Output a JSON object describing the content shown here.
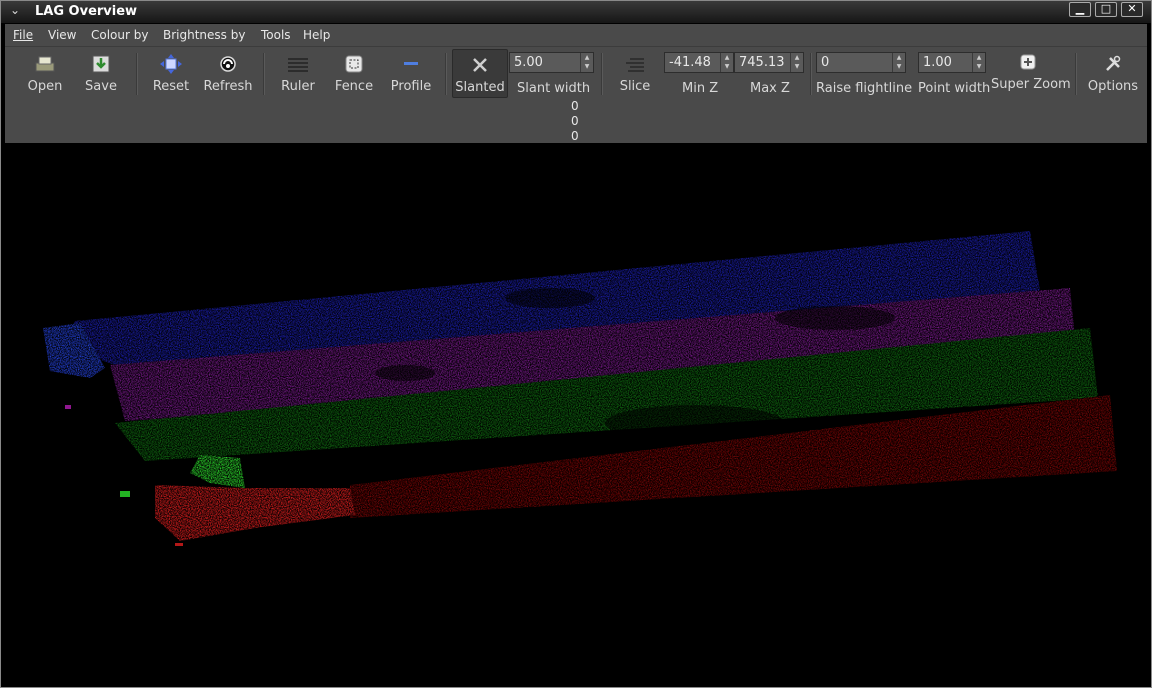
{
  "window": {
    "title": "LAG Overview",
    "minimize_glyph": "▁",
    "maximize_glyph": "□",
    "close_glyph": "✕"
  },
  "menu": [
    "File",
    "View",
    "Colour by",
    "Brightness by",
    "Tools",
    "Help"
  ],
  "toolbar": {
    "open": "Open",
    "save": "Save",
    "reset": "Reset",
    "refresh": "Refresh",
    "ruler": "Ruler",
    "fence": "Fence",
    "profile": "Profile",
    "slanted": "Slanted",
    "slant_width_label": "Slant width",
    "slant_width_value": "5.00",
    "slice": "Slice",
    "min_z_label": "Min Z",
    "min_z_value": "-41.48",
    "max_z_label": "Max Z",
    "max_z_value": "745.13",
    "raise_flightline_label": "Raise flightline",
    "raise_flightline_value": "0",
    "point_width_label": "Point width",
    "point_width_value": "1.00",
    "super_zoom": "Super Zoom",
    "options": "Options"
  },
  "status": [
    "0",
    "0",
    "0"
  ],
  "point_cloud": {
    "strip_colors": [
      "#1f23c8",
      "#8a1ea0",
      "#117a12",
      "#8c0a0a"
    ],
    "highlight_colors": [
      "#2a4cff",
      "#33ff33",
      "#ff2222"
    ],
    "icons": [
      "open-icon",
      "save-icon",
      "reset-icon",
      "refresh-icon",
      "ruler-icon",
      "fence-icon",
      "profile-icon",
      "close-x-icon",
      "slice-icon",
      "super-zoom-icon",
      "options-icon"
    ]
  }
}
